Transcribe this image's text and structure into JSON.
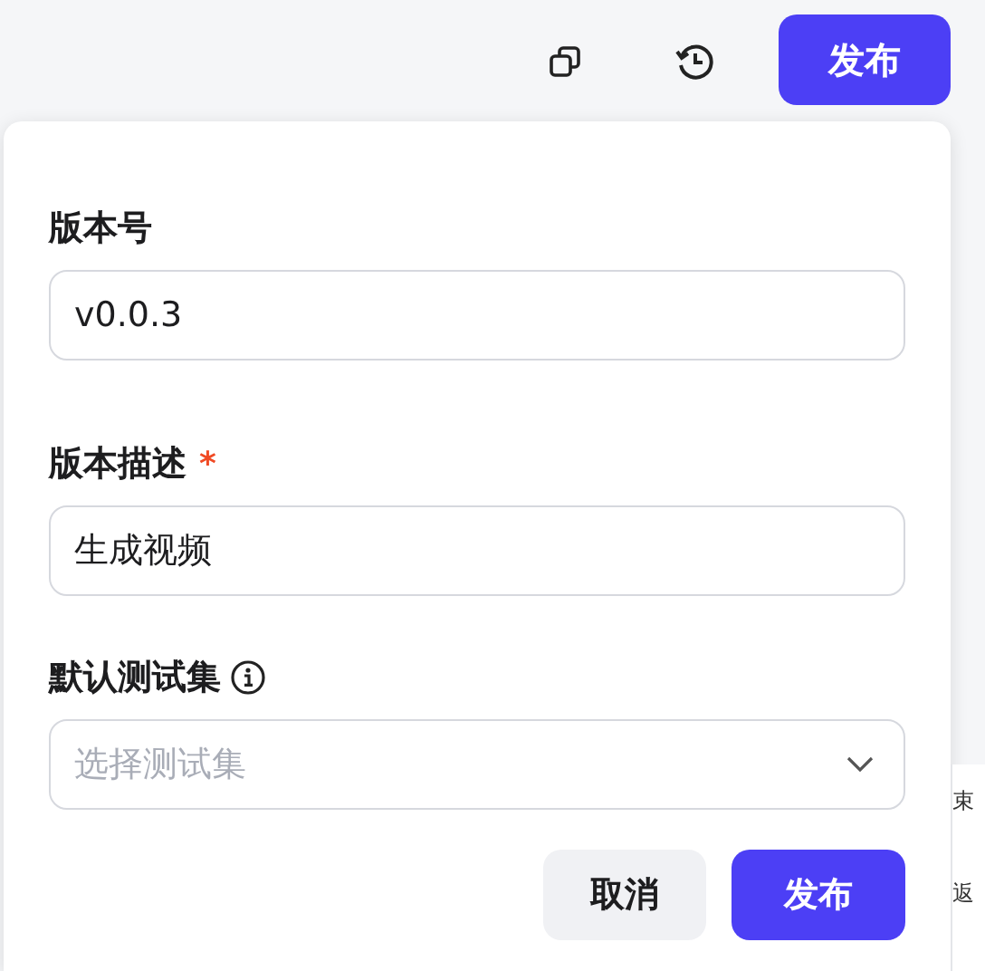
{
  "toolbar": {
    "publish_button": "发布"
  },
  "form": {
    "fields": [
      {
        "kind": "input",
        "label": "版本号",
        "value": "v0.0.3"
      },
      {
        "kind": "input",
        "label": "版本描述",
        "required_mark": "*",
        "value": "生成视频"
      },
      {
        "kind": "select_info",
        "label": "默认测试集",
        "placeholder": "选择测试集"
      }
    ],
    "buttons": [
      {
        "label": "取消",
        "kind": "secondary"
      },
      {
        "label": "发布",
        "kind": "primary"
      }
    ]
  },
  "background_texts": [
    "束",
    "返"
  ]
}
